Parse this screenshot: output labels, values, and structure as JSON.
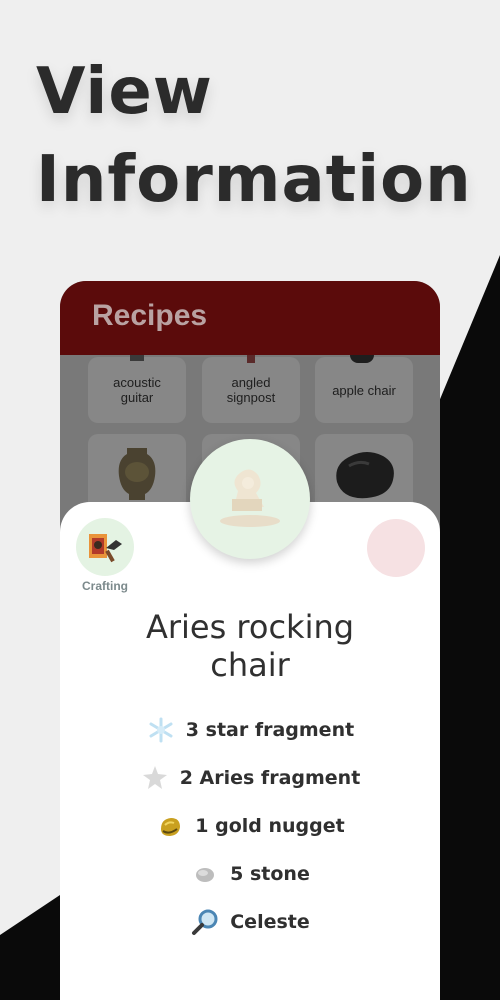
{
  "headline": {
    "line1": "View",
    "line2": "Information"
  },
  "app": {
    "title": "Recipes",
    "tiles": [
      {
        "label": "acoustic guitar"
      },
      {
        "label": "angled signpost"
      },
      {
        "label": "apple chair"
      }
    ]
  },
  "detail": {
    "category_label": "Crafting",
    "item_name_line1": "Aries rocking",
    "item_name_line2": "chair",
    "materials": [
      {
        "text": "3 star fragment",
        "icon": "star-fragment-icon"
      },
      {
        "text": "2 Aries fragment",
        "icon": "aries-fragment-icon"
      },
      {
        "text": "1 gold nugget",
        "icon": "gold-nugget-icon"
      },
      {
        "text": "5 stone",
        "icon": "stone-icon"
      },
      {
        "text": "Celeste",
        "icon": "magnifier-icon"
      }
    ]
  },
  "colors": {
    "background": "#efefef",
    "headline": "#2b2b2b",
    "header": "#5b0b0b",
    "sheet": "#ffffff",
    "accent_green": "#e4f3e3",
    "accent_pink": "#f6e1e3"
  }
}
